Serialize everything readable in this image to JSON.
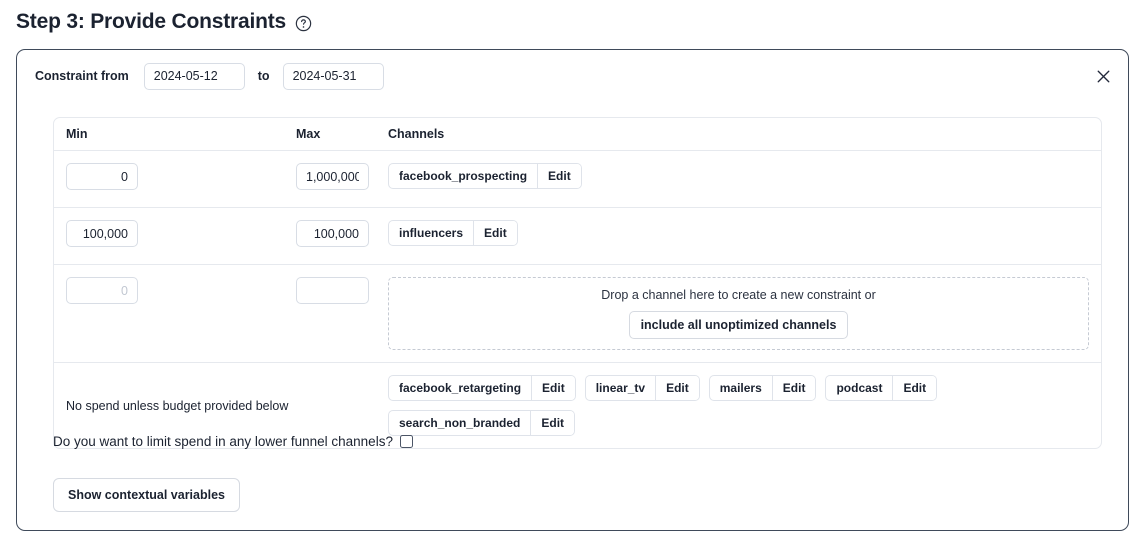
{
  "header": {
    "title": "Step 3: Provide Constraints",
    "help_icon": "question-circle-icon"
  },
  "card": {
    "close_icon": "close-icon",
    "constraint": {
      "label": "Constraint from",
      "from_value": "2024-05-12",
      "to_label": "to",
      "to_value": "2024-05-31"
    },
    "table": {
      "columns": [
        "Min",
        "Max",
        "Channels"
      ],
      "rows": [
        {
          "min_value": "0",
          "min_placeholder": "",
          "max_value": "1,000,000",
          "max_placeholder": "",
          "channels": [
            {
              "name": "facebook_prospecting",
              "edit_label": "Edit"
            }
          ]
        },
        {
          "min_value": "100,000",
          "min_placeholder": "",
          "max_value": "100,000",
          "max_placeholder": "",
          "channels": [
            {
              "name": "influencers",
              "edit_label": "Edit"
            }
          ]
        }
      ],
      "drop_row": {
        "min_value": "",
        "min_placeholder": "0",
        "max_value": "",
        "max_placeholder": "",
        "dropzone_text": "Drop a channel here to create a new constraint or",
        "dropzone_button": "include all unoptimized channels"
      },
      "no_spend_row": {
        "label": "No spend unless budget provided below",
        "channels": [
          {
            "name": "facebook_retargeting",
            "edit_label": "Edit"
          },
          {
            "name": "linear_tv",
            "edit_label": "Edit"
          },
          {
            "name": "mailers",
            "edit_label": "Edit"
          },
          {
            "name": "podcast",
            "edit_label": "Edit"
          },
          {
            "name": "search_non_branded",
            "edit_label": "Edit"
          }
        ]
      }
    },
    "limit_question": {
      "label": "Do you want to limit spend in any lower funnel channels?",
      "checked": false
    },
    "contextual_button": "Show contextual variables"
  },
  "colors": {
    "card_border": "#3f4a5a",
    "input_border": "#d8dde5",
    "table_border": "#e6e9ee",
    "text": "#1b2230",
    "placeholder": "#c2c8d2",
    "dropzone_border": "#c5cad3"
  }
}
